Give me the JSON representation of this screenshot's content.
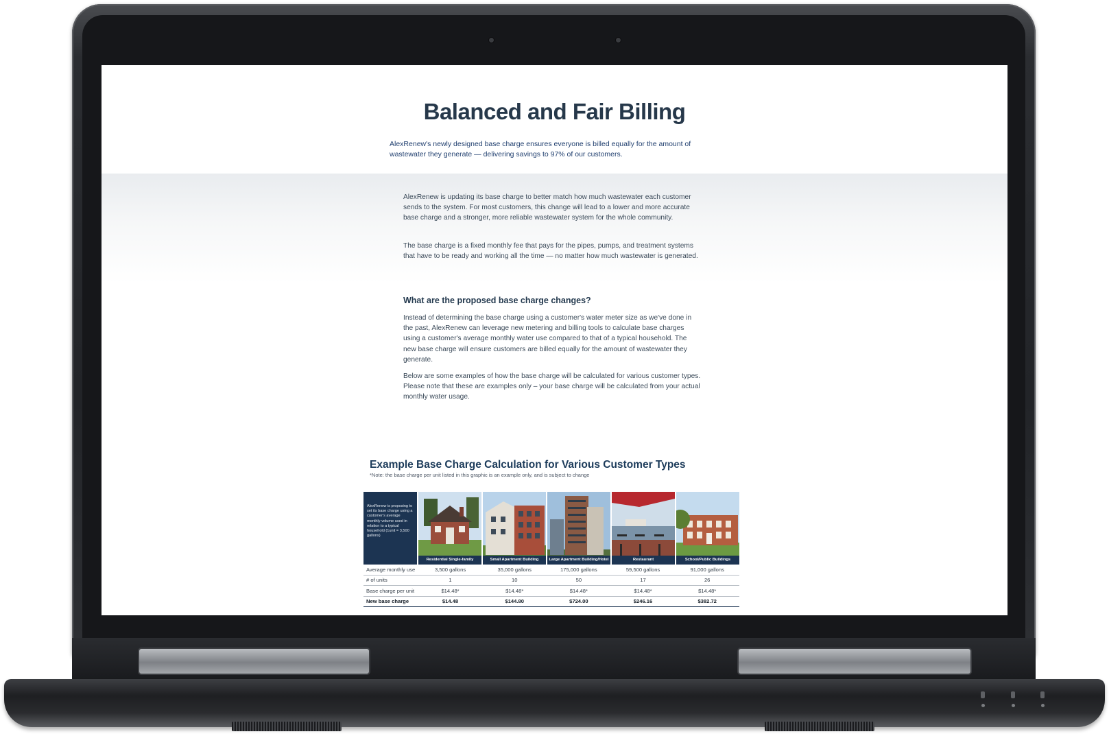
{
  "hero": {
    "title": "Balanced and Fair Billing",
    "subtitle": "AlexRenew's newly designed base charge ensures everyone is billed equally for the amount of wastewater they generate — delivering savings to 97% of our customers."
  },
  "intro": {
    "p1": "AlexRenew is updating its base charge to better match how much wastewater each customer sends to the system. For most customers, this change will lead to a lower and more accurate base charge and a stronger, more reliable wastewater system for the whole community.",
    "p2": "The base charge is a fixed monthly fee that pays for the pipes, pumps, and treatment systems that have to be ready and working all the time — no matter how much wastewater is generated."
  },
  "changes": {
    "heading": "What are the proposed base charge changes?",
    "p1": "Instead of determining the base charge using a customer's water meter size as we've done in the past, AlexRenew can leverage new metering and billing tools to calculate base charges using a customer's average monthly water use compared to that of a typical household. The new base charge will ensure customers are billed equally for the amount of wastewater they generate.",
    "p2": "Below are some examples of how the base charge will be calculated for various customer types. Please note that these are examples only – your base charge will be calculated from your actual monthly water usage."
  },
  "example": {
    "title": "Example Base Charge Calculation for Various Customer Types",
    "note": "*Note: the base charge per unit listed in this graphic is an example only, and is subject to change",
    "intro_text": "AlexRenew is proposing to set its base charge using a customer's average monthly volume used in relation to a typical household (1unit = 3,500 gallons)",
    "columns": [
      "Residential Single-family",
      "Small Apartment Building",
      "Large Apartment Building/Hotel",
      "Restaurant",
      "School/Public Buildings"
    ],
    "rows": [
      {
        "label": "Average monthly use",
        "values": [
          "3,500 gallons",
          "35,000 gallons",
          "175,000 gallons",
          "59,500 gallons",
          "91,000 gallons"
        ]
      },
      {
        "label": "# of units",
        "values": [
          "1",
          "10",
          "50",
          "17",
          "26"
        ]
      },
      {
        "label": "Base charge per unit",
        "values": [
          "$14.48*",
          "$14.48*",
          "$14.48*",
          "$14.48*",
          "$14.48*"
        ]
      },
      {
        "label": "New base charge",
        "values": [
          "$14.48",
          "$144.80",
          "$724.00",
          "$246.16",
          "$382.72"
        ]
      }
    ]
  }
}
